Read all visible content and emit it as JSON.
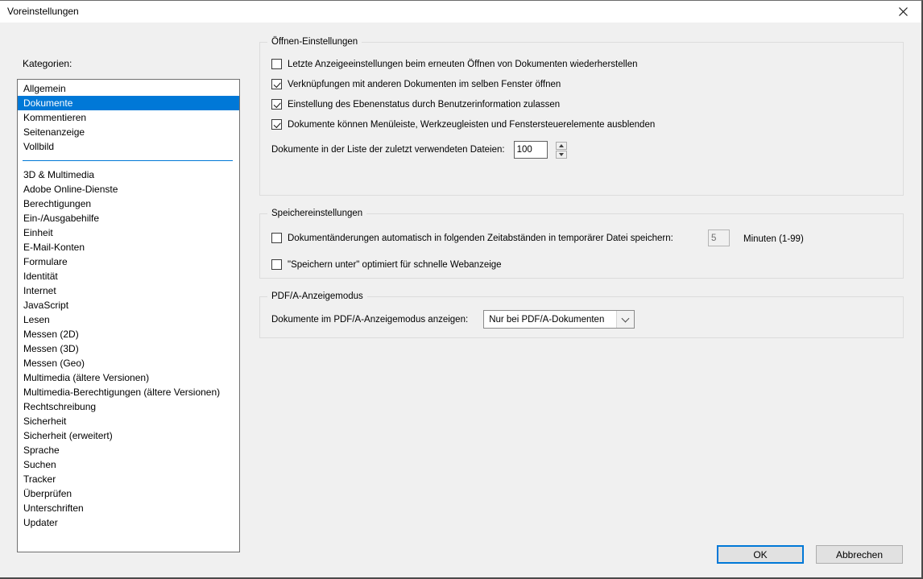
{
  "window": {
    "title": "Voreinstellungen"
  },
  "colors": {
    "selection": "#0078d7",
    "dialog_bg": "#f0f0f0",
    "titlebar_bg": "#ffffff"
  },
  "sidebar": {
    "label": "Kategorien:",
    "selected_item": "Dokumente",
    "primary_items": [
      "Allgemein",
      "Dokumente",
      "Kommentieren",
      "Seitenanzeige",
      "Vollbild"
    ],
    "secondary_items": [
      "3D & Multimedia",
      "Adobe Online-Dienste",
      "Berechtigungen",
      "Ein-/Ausgabehilfe",
      "Einheit",
      "E-Mail-Konten",
      "Formulare",
      "Identität",
      "Internet",
      "JavaScript",
      "Lesen",
      "Messen (2D)",
      "Messen (3D)",
      "Messen (Geo)",
      "Multimedia (ältere Versionen)",
      "Multimedia-Berechtigungen (ältere Versionen)",
      "Rechtschreibung",
      "Sicherheit",
      "Sicherheit (erweitert)",
      "Sprache",
      "Suchen",
      "Tracker",
      "Überprüfen",
      "Unterschriften",
      "Updater"
    ]
  },
  "open_settings": {
    "title": "Öffnen-Einstellungen",
    "checkboxes": [
      {
        "label": "Letzte Anzeigeeinstellungen beim erneuten Öffnen von Dokumenten wiederherstellen",
        "checked": false
      },
      {
        "label": "Verknüpfungen mit anderen Dokumenten im selben Fenster öffnen",
        "checked": true
      },
      {
        "label": "Einstellung des Ebenenstatus durch Benutzerinformation zulassen",
        "checked": true
      },
      {
        "label": "Dokumente können Menüleiste, Werkzeugleisten und Fenstersteuerelemente ausblenden",
        "checked": true
      }
    ],
    "recent_files": {
      "label": "Dokumente in der Liste der zuletzt verwendeten Dateien:",
      "value": "100"
    }
  },
  "save_settings": {
    "title": "Speichereinstellungen",
    "autosave": {
      "label": "Dokumentänderungen automatisch in folgenden Zeitabständen in temporärer Datei speichern:",
      "checked": false,
      "value": "5",
      "unit_label": "Minuten (1-99)"
    },
    "fast_web": {
      "label": "\"Speichern unter\" optimiert für schnelle Webanzeige",
      "checked": false
    }
  },
  "pdfa": {
    "title": "PDF/A-Anzeigemodus",
    "label": "Dokumente im PDF/A-Anzeigemodus anzeigen:",
    "selected_option": "Nur bei PDF/A-Dokumenten"
  },
  "footer": {
    "ok_label": "OK",
    "cancel_label": "Abbrechen"
  }
}
